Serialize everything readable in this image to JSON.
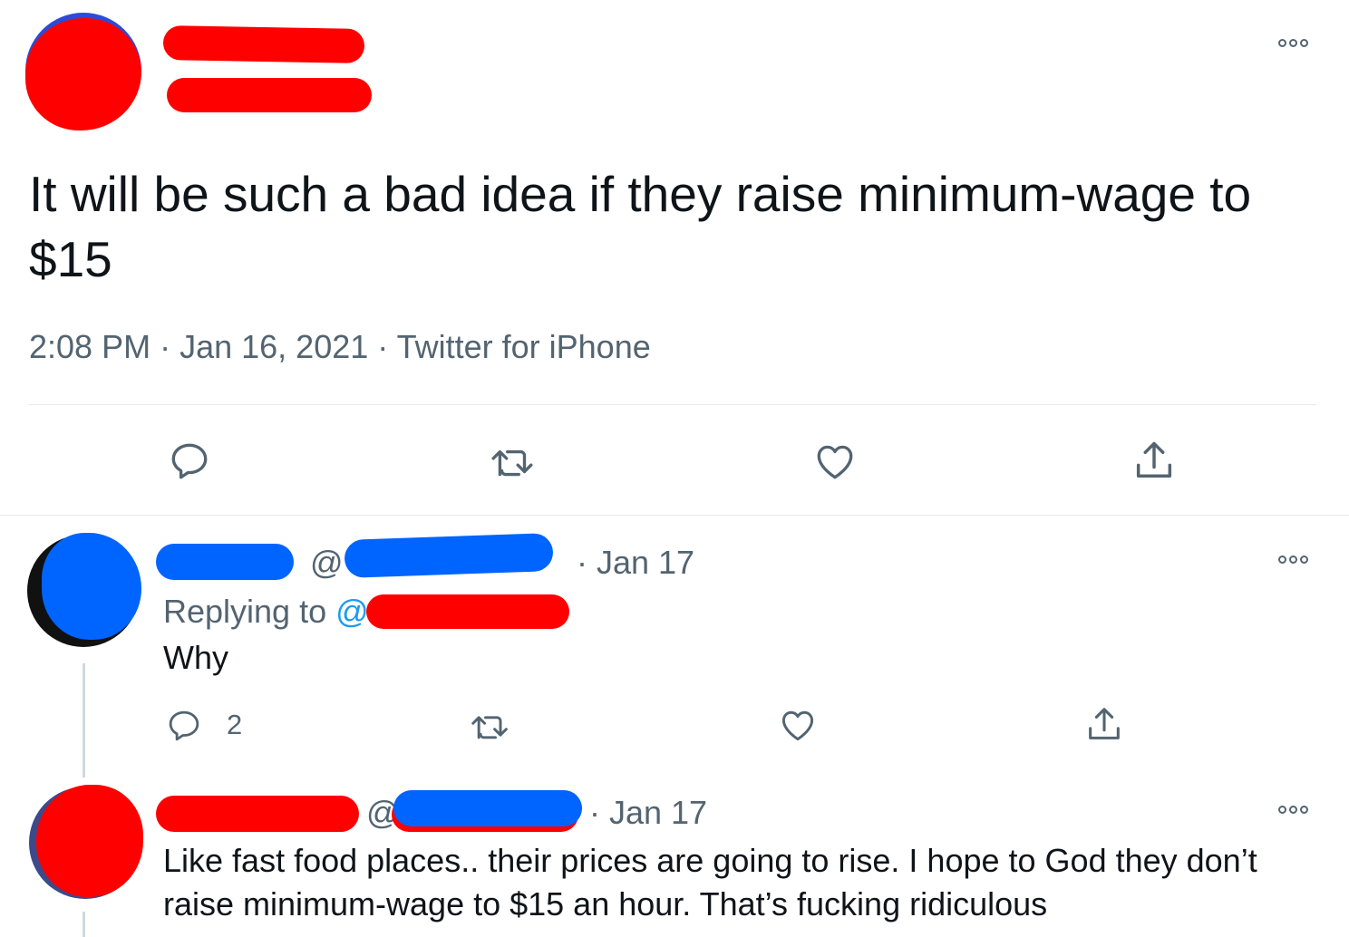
{
  "main_tweet": {
    "text": "It will be such a bad idea if they raise minimum-wage to $15",
    "time": "2:08 PM",
    "sep1": " · ",
    "date": "Jan 16, 2021",
    "sep2": " · ",
    "source": "Twitter for iPhone",
    "icons": [
      "reply-icon",
      "retweet-icon",
      "like-icon",
      "share-icon",
      "more-icon"
    ]
  },
  "reply1": {
    "at": "@",
    "date": "· Jan 17",
    "replying_to_label": "Replying to ",
    "replying_to_at": "@",
    "text": "Why",
    "reply_count": "2",
    "icons": [
      "reply-icon",
      "retweet-icon",
      "like-icon",
      "share-icon",
      "more-icon"
    ]
  },
  "reply2": {
    "at": "@",
    "date": "· Jan 17",
    "text": "Like fast food places.. their prices are going to rise. I hope to God they don’t raise minimum-wage to $15 an hour. That’s fucking ridiculous",
    "icons": [
      "more-icon"
    ]
  },
  "colors": {
    "text": "#0f1419",
    "secondary": "#536471",
    "link": "#1d9bf0",
    "divider": "#e6e9eb",
    "redaction_red": "#ff0000",
    "redaction_blue": "#0064ff"
  }
}
